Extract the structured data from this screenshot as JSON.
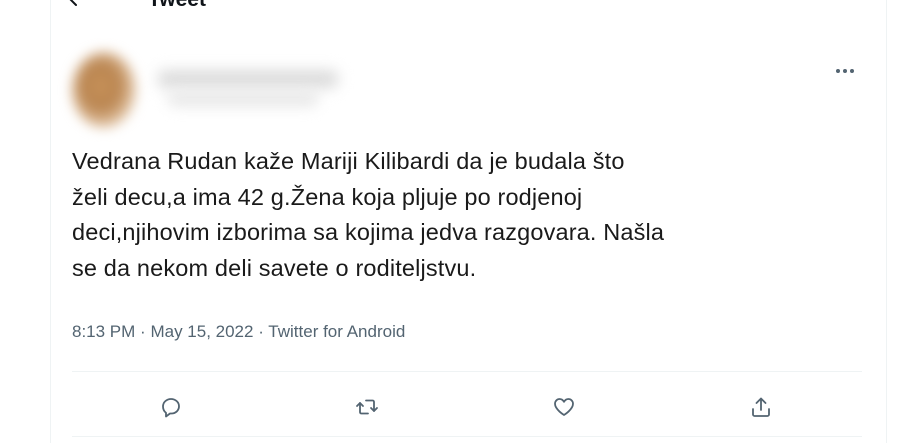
{
  "header": {
    "title": "Tweet",
    "back_icon": "arrow-left-icon"
  },
  "tweet": {
    "text_lines": [
      "Vedrana Rudan kaže Mariji Kilibardi da je budala što",
      "želi decu,a ima 42 g.Žena koja pljuje po rodjenoj",
      "deci,njihovim izborima sa kojima jedva razgovara. Našla",
      "se da nekom deli savete o roditeljstvu."
    ],
    "time": "8:13 PM",
    "date": "May 15, 2022",
    "separator": "·",
    "source": "Twitter for Android"
  },
  "actions": [
    {
      "name": "reply-icon"
    },
    {
      "name": "retweet-icon"
    },
    {
      "name": "like-icon"
    },
    {
      "name": "share-icon"
    }
  ],
  "colors": {
    "text": "#0f1419",
    "secondary": "#536471",
    "border": "#eff3f4"
  }
}
